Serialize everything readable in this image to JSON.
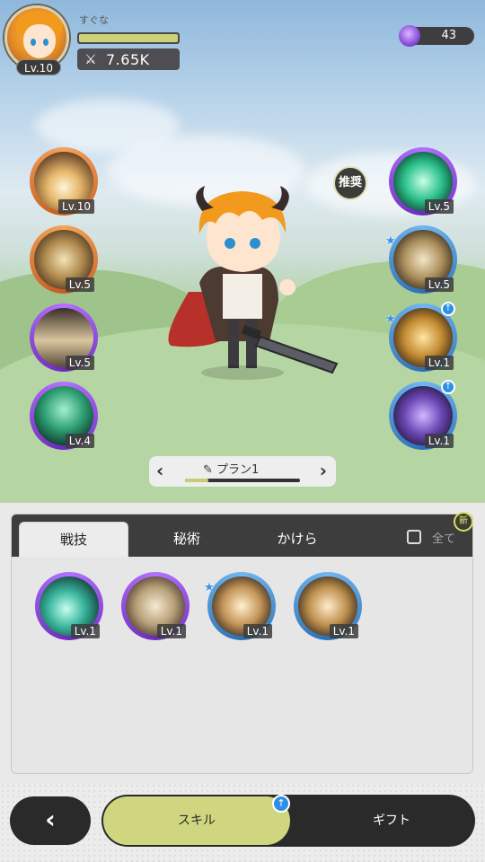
{
  "player": {
    "level": "Lv.10",
    "name": "すぐな",
    "exp_fraction": 1.0,
    "power": "7.65K"
  },
  "currency": {
    "gems": "43"
  },
  "equipped_left": [
    {
      "level": "Lv.10",
      "color": "orange",
      "icon": "burst-skill-icon"
    },
    {
      "level": "Lv.5",
      "color": "orange",
      "icon": "spin-slash-icon"
    },
    {
      "level": "Lv.5",
      "color": "purple",
      "icon": "spike-wall-icon"
    },
    {
      "level": "Lv.4",
      "color": "purple",
      "icon": "green-blades-icon"
    }
  ],
  "equipped_right": [
    {
      "level": "Lv.5",
      "color": "purple",
      "icon": "green-sword-icon"
    },
    {
      "level": "Lv.5",
      "color": "blue",
      "icon": "sword-buff-icon",
      "star": true
    },
    {
      "level": "Lv.1",
      "color": "blue",
      "icon": "golden-shield-icon",
      "star": true,
      "upgrade": true
    },
    {
      "level": "Lv.1",
      "color": "blue",
      "icon": "shadow-dash-icon",
      "upgrade": true
    }
  ],
  "recommend_label": "推奨",
  "plan": {
    "label": "プラン1",
    "progress_fraction": 0.2
  },
  "panel": {
    "tabs": [
      "戦技",
      "秘術",
      "かけら"
    ],
    "active_tab": 0,
    "filter_label": "全て",
    "new_badge": "新",
    "skills": [
      {
        "level": "Lv.1",
        "color": "purple",
        "icon": "teal-slash-icon"
      },
      {
        "level": "Lv.1",
        "color": "purple",
        "icon": "afterimage-icon"
      },
      {
        "level": "Lv.1",
        "color": "blue",
        "icon": "fire-punch-icon",
        "star": true
      },
      {
        "level": "Lv.1",
        "color": "blue",
        "icon": "crescent-slash-icon"
      }
    ]
  },
  "bottom_nav": {
    "back_label": "‹",
    "skill_label": "スキル",
    "gift_label": "ギフト",
    "upgrade_glyph": "↑"
  }
}
